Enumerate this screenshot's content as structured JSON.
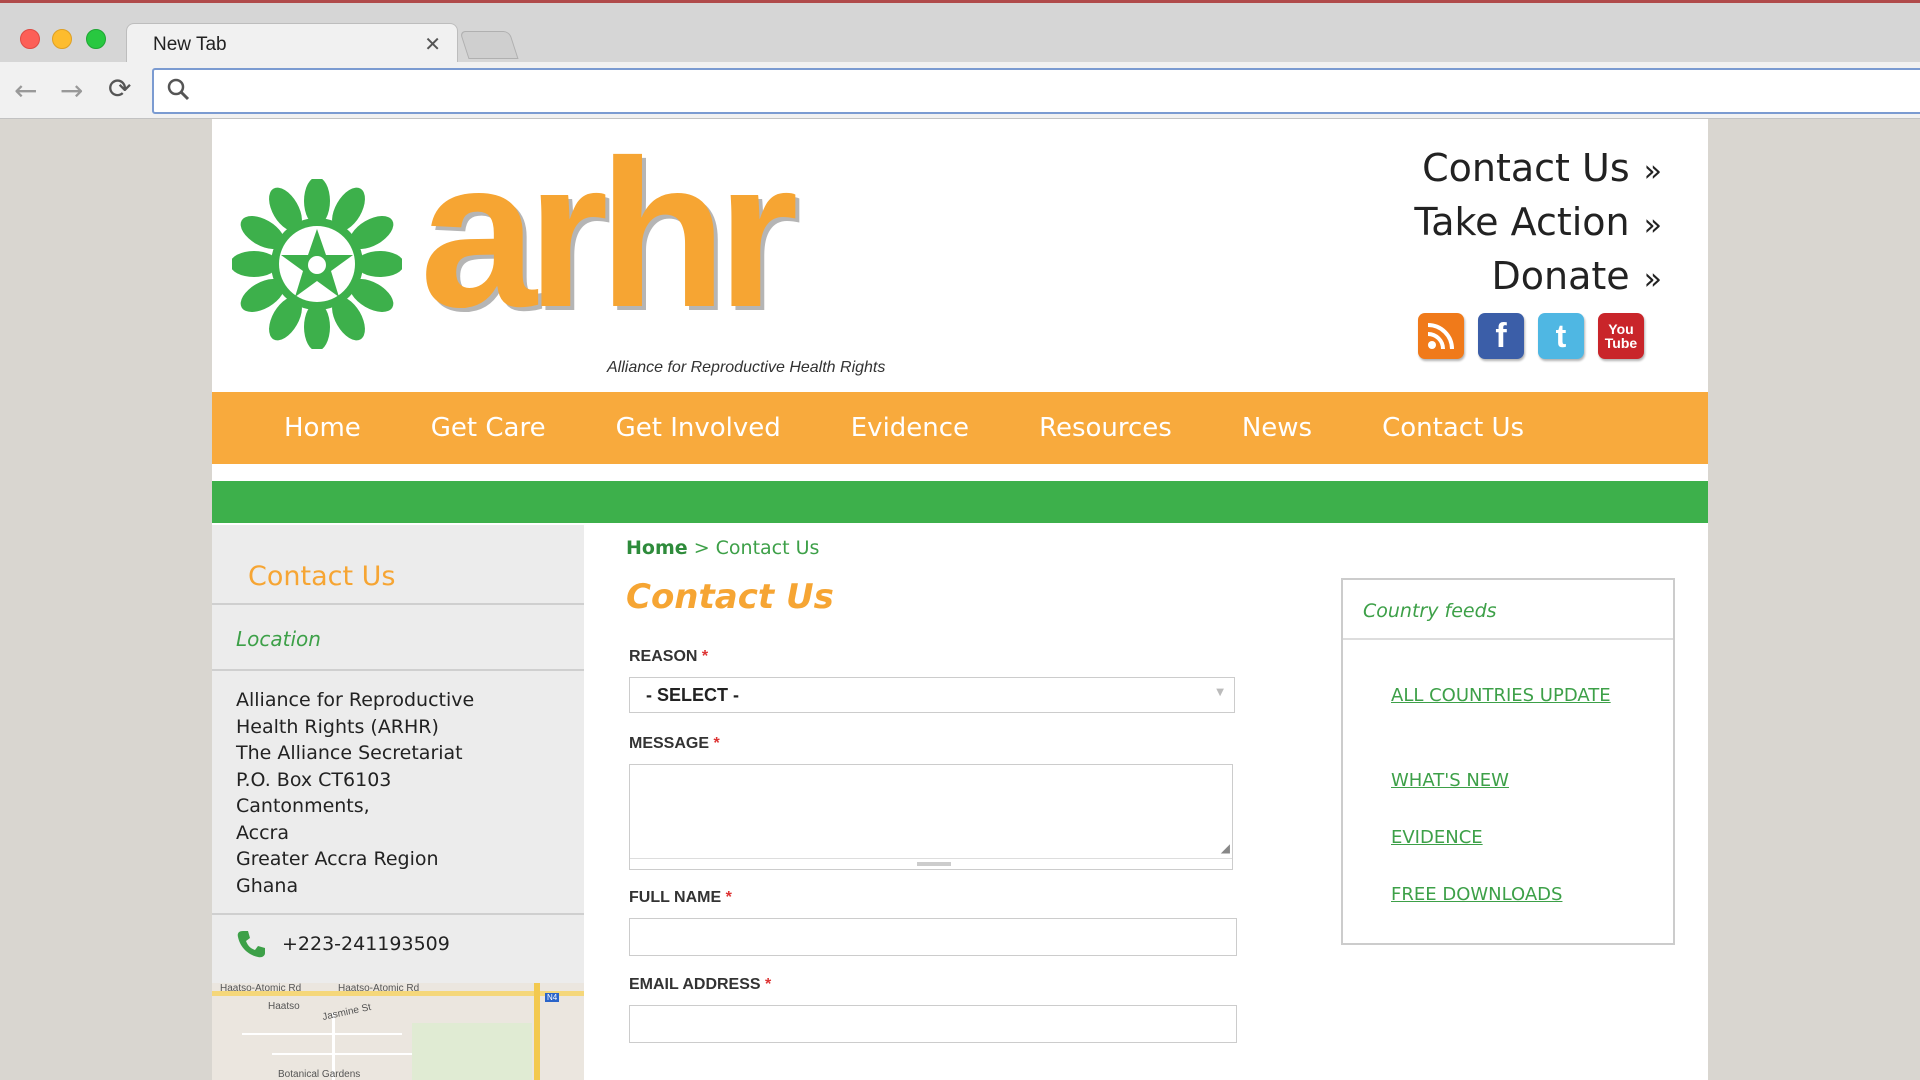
{
  "browser": {
    "tab_title": "New Tab",
    "tab_close": "✕",
    "back": "←",
    "forward": "→",
    "reload": "⟳",
    "address_value": ""
  },
  "header": {
    "logo_text": "arhr",
    "tagline": "Alliance for Reproductive Health Rights",
    "top_links": [
      {
        "label": "Contact Us",
        "chevron": "»"
      },
      {
        "label": "Take Action",
        "chevron": "»"
      },
      {
        "label": "Donate",
        "chevron": "»"
      }
    ],
    "social": {
      "rss": "rss-icon",
      "facebook": "f",
      "twitter": "t",
      "youtube_top": "You",
      "youtube_bottom": "Tube"
    }
  },
  "nav": {
    "items": [
      "Home",
      "Get Care",
      "Get Involved",
      "Evidence",
      "Resources",
      "News",
      "Contact Us"
    ]
  },
  "sidebar": {
    "heading": "Contact Us",
    "location_label": "Location",
    "address_lines": [
      "Alliance for Reproductive",
      "Health Rights (ARHR)",
      "The Alliance Secretariat",
      "P.O. Box CT6103",
      "Cantonments,",
      "Accra",
      "Greater Accra Region",
      "Ghana"
    ],
    "phone": "+223-241193509",
    "map_labels": {
      "road1": "Haatso-Atomic Rd",
      "road2": "Haatso-Atomic Rd",
      "area": "Haatso",
      "street": "Jasmine St",
      "place": "Botanical Gardens",
      "badge": "N4"
    }
  },
  "content": {
    "breadcrumb_home": "Home",
    "breadcrumb_sep": ">",
    "breadcrumb_current": "Contact Us",
    "title": "Contact Us",
    "required_mark": "*",
    "form": {
      "reason_label": "REASON",
      "reason_value": "- SELECT -",
      "message_label": "MESSAGE",
      "full_name_label": "FULL NAME",
      "email_label": "EMAIL ADDRESS"
    }
  },
  "feeds": {
    "title": "Country feeds",
    "links": [
      "ALL COUNTRIES UPDATE",
      "WHAT'S NEW",
      "EVIDENCE",
      "FREE DOWNLOADS"
    ]
  },
  "colors": {
    "orange": "#f8aa3d",
    "green": "#3db04b",
    "text_green": "#3da048"
  }
}
